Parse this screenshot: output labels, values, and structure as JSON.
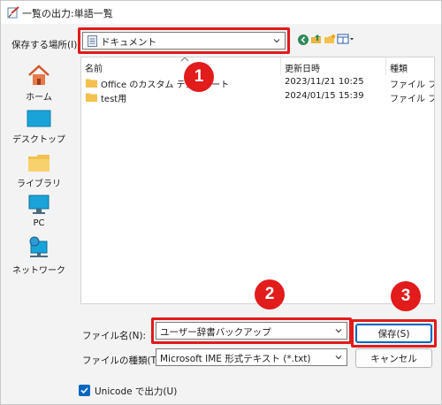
{
  "window": {
    "title": "一覧の出力:単語一覧"
  },
  "location": {
    "label": "保存する場所(I):",
    "value": "ドキュメント"
  },
  "places": [
    {
      "label": "ホーム",
      "icon": "home-icon"
    },
    {
      "label": "デスクトップ",
      "icon": "desktop-icon"
    },
    {
      "label": "ライブラリ",
      "icon": "library-icon"
    },
    {
      "label": "PC",
      "icon": "pc-icon"
    },
    {
      "label": "ネットワーク",
      "icon": "network-icon"
    }
  ],
  "file_list": {
    "columns": [
      "名前",
      "更新日時",
      "種類"
    ],
    "rows": [
      {
        "name": "Office のカスタム テンプレート",
        "modified": "2023/11/21 10:25",
        "type": "ファイル フォルダー"
      },
      {
        "name": "test用",
        "modified": "2024/01/15 15:39",
        "type": "ファイル フォルダー"
      }
    ]
  },
  "filename": {
    "label": "ファイル名(N):",
    "value": "ユーザー辞書バックアップ"
  },
  "filetype": {
    "label": "ファイルの種類(T):",
    "value": "Microsoft IME 形式テキスト (*.txt)"
  },
  "buttons": {
    "save": "保存(S)",
    "cancel": "キャンセル"
  },
  "unicode": {
    "label": "Unicode で出力(U)",
    "checked": true
  },
  "callouts": [
    "1",
    "2",
    "3"
  ],
  "colors": {
    "accent": "#0067c0",
    "highlight": "#e21b1b"
  }
}
